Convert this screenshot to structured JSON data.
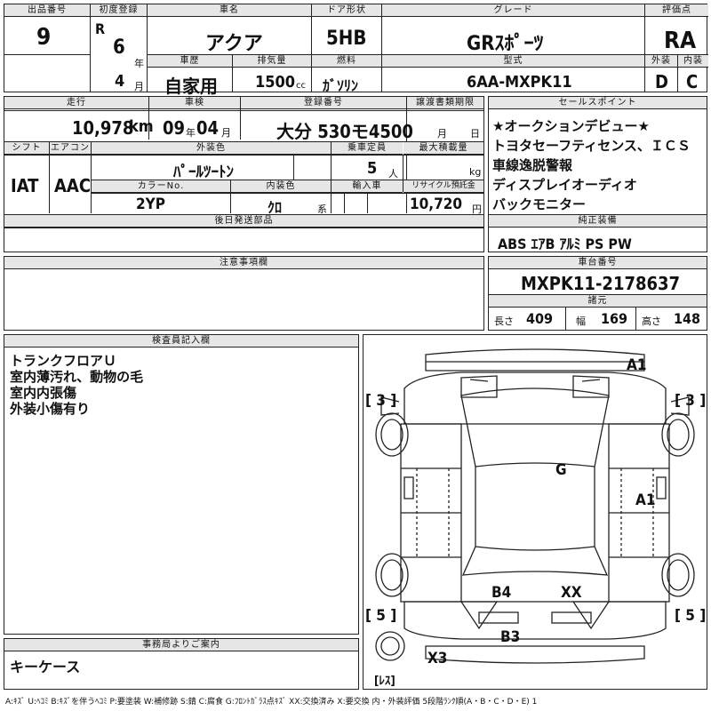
{
  "header": {
    "lot_label": "出品番号",
    "lot": "9",
    "first_reg_label": "初度登録",
    "era": "R",
    "year": "6",
    "year_unit": "年",
    "month": "4",
    "month_unit": "月",
    "car_name_label": "車名",
    "car_name": "アクア",
    "door_label": "ドア形状",
    "door": "5HB",
    "grade_label": "グレード",
    "grade": "GRｽﾎﾟｰﾂ",
    "score_label": "評価点",
    "score": "RA",
    "history_label": "車歴",
    "history": "自家用",
    "displacement_label": "排気量",
    "displacement": "1500",
    "displacement_unit": "cc",
    "fuel_label": "燃料",
    "fuel": "ｶﾞｿﾘﾝ",
    "model_label": "型式",
    "model": "6AA-MXPK11",
    "exterior_label": "外装",
    "exterior": "D",
    "interior_label": "内装",
    "interior": "C"
  },
  "row2": {
    "mileage_label": "走行",
    "mileage": "10,978",
    "mileage_unit": "km",
    "inspection_label": "車検",
    "insp_year": "09",
    "insp_year_unit": "年",
    "insp_month": "04",
    "insp_month_unit": "月",
    "plate_label": "登録番号",
    "plate": "大分 530モ4500",
    "transfer_label": "譲渡書類期限",
    "transfer_month": "月",
    "transfer_day": "日",
    "shift_label": "シフト",
    "shift": "IAT",
    "ac_label": "エアコン",
    "ac": "AAC",
    "exterior_color_label": "外装色",
    "exterior_color": "ﾊﾟｰﾙﾂｰﾄﾝ",
    "capacity_label": "乗車定員",
    "capacity": "5",
    "capacity_unit": "人",
    "load_label": "最大積載量",
    "load_unit": "kg",
    "color_no_label": "カラーNo.",
    "color_no": "2YP",
    "interior_color_label": "内装色",
    "interior_color": "ｸﾛ",
    "interior_color_unit": "系",
    "import_label": "輸入車",
    "recycle_label": "リサイクル預託金",
    "recycle": "10,720",
    "recycle_unit": "円",
    "later_parts_label": "後日発送部品"
  },
  "sales_points": {
    "label": "セールスポイント",
    "items": [
      "★オークションデビュー★",
      "トヨタセーフティセンス、ＩＣＳ",
      "車線逸脱警報",
      "ディスプレイオーディオ",
      "バックモニター"
    ]
  },
  "equipment": {
    "label": "純正装備",
    "value": "ABS ｴｱB ｱﾙﾐ PS PW"
  },
  "notes": {
    "label": "注意事項欄"
  },
  "chassis": {
    "label": "車台番号",
    "value": "MXPK11-2178637",
    "spec_label": "諸元",
    "length_label": "長さ",
    "length": "409",
    "width_label": "幅",
    "width": "169",
    "height_label": "高さ",
    "height": "148"
  },
  "inspector": {
    "label": "検査員記入欄",
    "lines": [
      "トランクフロアＵ",
      "室内薄汚れ、動物の毛",
      "室内内張傷",
      "外装小傷有り"
    ]
  },
  "office": {
    "label": "事務局よりご案内",
    "text": "キーケース"
  },
  "diagram": {
    "marks": {
      "front_bumper": "A1",
      "left_front_tire": "[ 3 ]",
      "right_front_tire": "[ 3 ]",
      "windshield": "G",
      "right_side": "A1",
      "left_rear_tire": "[ 5 ]",
      "right_rear_tire": "[ 5 ]",
      "rear_left": "B4",
      "rear_right": "XX",
      "rear_bumper": "B3",
      "rear_x": "X3",
      "spare": "[ﾚｽ]"
    }
  },
  "legend": "A:ｷｽﾞ U:ﾍｺﾐ B:ｷｽﾞを伴うﾍｺﾐ P:要塗装 W:補修跡 S:錆 C:腐食 G:ﾌﾛﾝﾄｶﾞﾗｽ点ｷｽﾞ XX:交換済み X:要交換 内・外装評価 5段階ﾗﾝｸ順(A・B・C・D・E) 1"
}
